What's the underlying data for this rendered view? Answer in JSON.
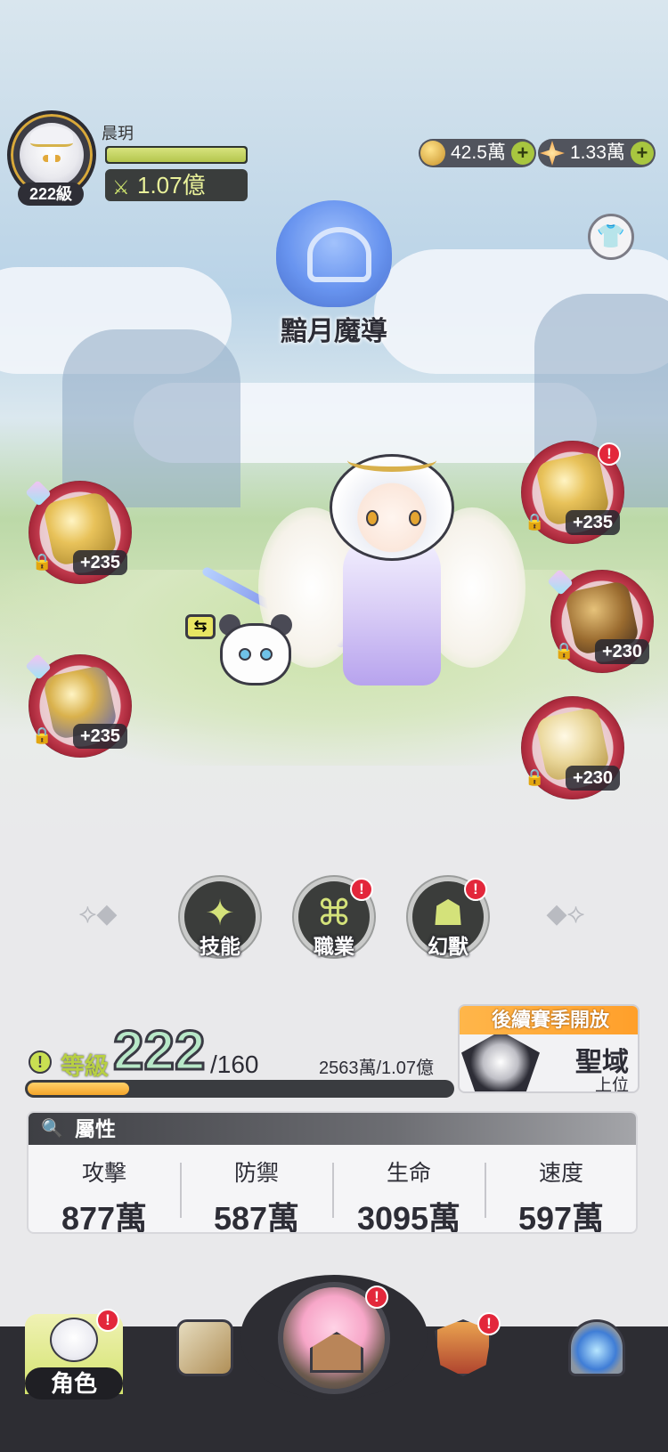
{
  "player": {
    "name": "晨玥",
    "level_badge": "222級",
    "combat_power": "1.07億"
  },
  "currencies": [
    {
      "icon": "gold-coin-icon",
      "value": "42.5萬",
      "color": "#d6a93b"
    },
    {
      "icon": "crystal-star-icon",
      "value": "1.33萬",
      "color": "#f08a2a"
    }
  ],
  "character": {
    "class_name": "黯月魔導"
  },
  "equipment": {
    "left": [
      {
        "name": "weapon",
        "enhance": "+235",
        "locked": true,
        "alert": false
      },
      {
        "name": "book",
        "enhance": "+235",
        "locked": true,
        "alert": false
      }
    ],
    "right": [
      {
        "name": "helmet",
        "enhance": "+235",
        "locked": true,
        "alert": true,
        "alert_text": "!"
      },
      {
        "name": "armor",
        "enhance": "+230",
        "locked": true,
        "alert": false
      },
      {
        "name": "boots",
        "enhance": "+230",
        "locked": true,
        "alert": false
      }
    ]
  },
  "skills": [
    {
      "label": "技能",
      "alert": false
    },
    {
      "label": "職業",
      "alert": true,
      "alert_text": "!"
    },
    {
      "label": "幻獸",
      "alert": true,
      "alert_text": "!"
    }
  ],
  "level": {
    "label": "等級",
    "value": "222",
    "max": "/160",
    "exp_text": "2563萬/1.07億",
    "exp_fraction": 0.24,
    "alert_text": "!"
  },
  "season": {
    "banner": "後續賽季開放",
    "name": "聖域",
    "rank": "上位"
  },
  "attributes": {
    "title": "屬性",
    "items": [
      {
        "name": "攻擊",
        "value": "877萬"
      },
      {
        "name": "防禦",
        "value": "587萬"
      },
      {
        "name": "生命",
        "value": "3095萬"
      },
      {
        "name": "速度",
        "value": "597萬"
      }
    ]
  },
  "nav": {
    "role_label": "角色",
    "alert_text": "!"
  }
}
